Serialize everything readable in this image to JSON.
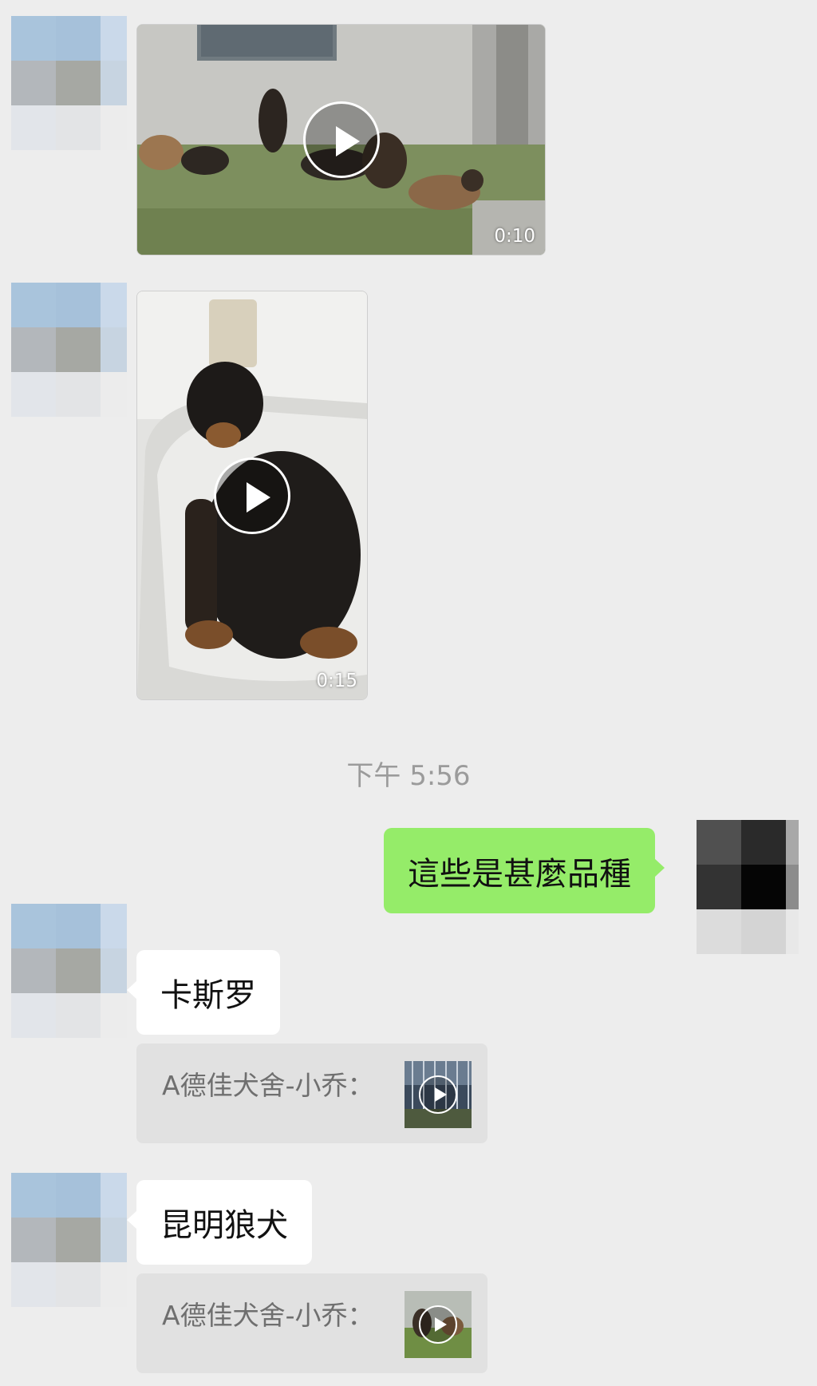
{
  "chat": {
    "messages": [
      {
        "sender": "friend",
        "type": "video",
        "duration": "0:10",
        "scene_icon": "dogs-yard-scene"
      },
      {
        "sender": "friend",
        "type": "video",
        "duration": "0:15",
        "scene_icon": "doberman-puppy-scene"
      },
      {
        "type": "timestamp",
        "text": "下午 5:56"
      },
      {
        "sender": "me",
        "type": "text",
        "text": "這些是甚麼品種"
      },
      {
        "sender": "friend",
        "type": "text",
        "text": "卡斯罗",
        "quote": {
          "text": "A德佳犬舍-小乔：",
          "thumb_icon": "video-thumbnail"
        }
      },
      {
        "sender": "friend",
        "type": "text",
        "text": "昆明狼犬",
        "quote": {
          "text": "A德佳犬舍-小乔：",
          "thumb_icon": "video-thumbnail"
        }
      }
    ]
  },
  "colors": {
    "background": "#ededed",
    "my_bubble": "#95ec69",
    "friend_bubble": "#ffffff",
    "quote_block": "#e1e1e1",
    "timestamp": "#9b9b9b"
  }
}
